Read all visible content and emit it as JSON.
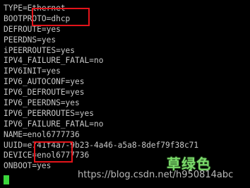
{
  "terminal": {
    "lines": [
      "TYPE=Ethernet",
      "BOOTPROTO=dhcp",
      "DEFROUTE=yes",
      "PEERDNS=yes",
      "iPEERROUTES=yes",
      "IPV4_FAILURE_FATAL=no",
      "IPV6INIT=yes",
      "IPV6_AUTOCONF=yes",
      "IPV6_DEFROUTE=yes",
      "IPV6_PEERDNS=yes",
      "IPV6_PEERROUTES=yes",
      "IPV6_FAILURE_FATAL=no",
      "NAME=enol6777736",
      "UUID=e741f4a7-9b23-4a46-a5a8-8def79f38c71",
      "DEVICE=enol6777736",
      "ONBOOT=yes"
    ]
  },
  "watermark": {
    "url": "https://blog.csdn.net/h950814abc",
    "brand": "草绿色"
  },
  "colors": {
    "background": "#000000",
    "text": "#c8c8c8",
    "highlight_box": "#e3141a",
    "cursor": "#3bd63b",
    "brand": "#7ad96a"
  }
}
